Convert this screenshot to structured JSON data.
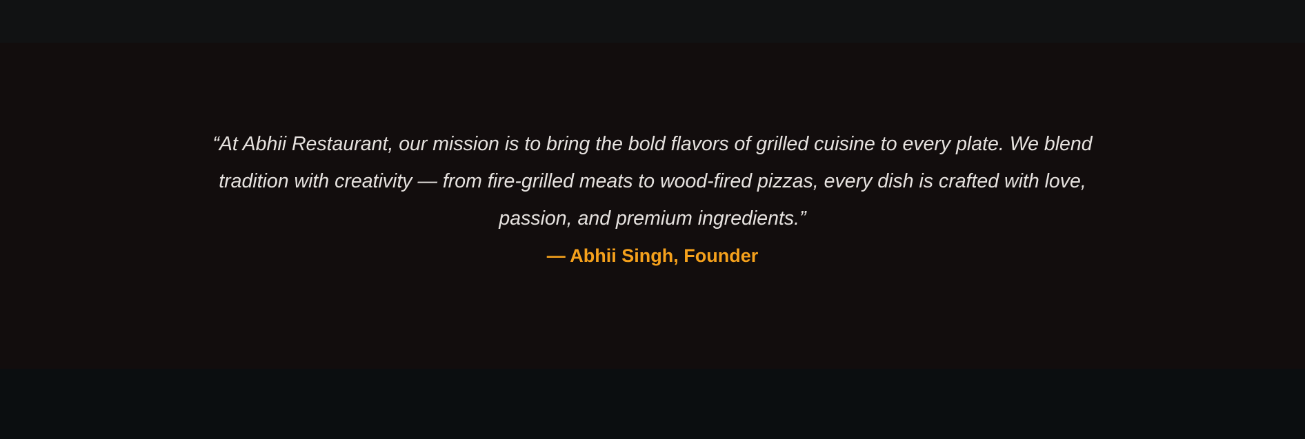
{
  "quote": {
    "text": "“At Abhii Restaurant, our mission is to bring the bold flavors of grilled cuisine to every plate. We blend tradition with creativity — from fire-grilled meats to wood-fired pizzas, every dish is crafted with love, passion, and premium ingredients.”",
    "author": "— Abhii Singh, Founder"
  },
  "colors": {
    "section_bg": "#120d0d",
    "top_band": "#111213",
    "bottom_band": "#0b0e10",
    "quote_text": "#e6e2df",
    "accent": "#f5a11c"
  }
}
